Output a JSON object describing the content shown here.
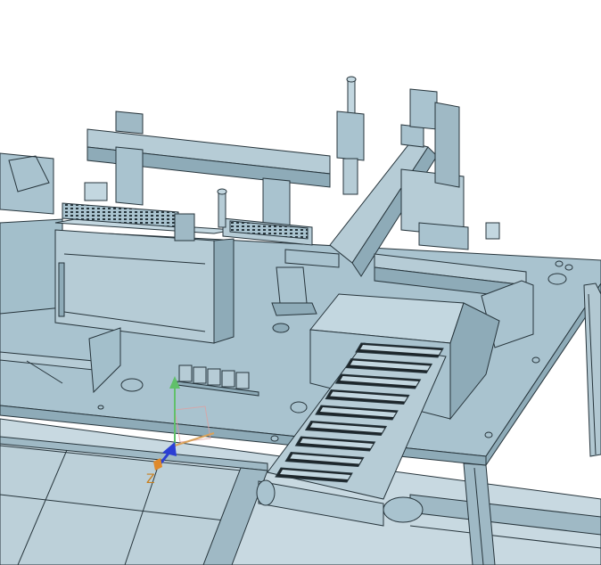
{
  "viewport": {
    "background": "#ffffff",
    "model_fill": "#a9c3cf",
    "model_fill_light": "#c3d7e0",
    "model_fill_dark": "#8eabb8",
    "edge_color": "#27353c"
  },
  "triad": {
    "z_label": "Z",
    "x_color": "#d9a25c",
    "y_color": "#61c06a",
    "z_color": "#2b3fd4",
    "origin_color": "#e08a2c"
  }
}
